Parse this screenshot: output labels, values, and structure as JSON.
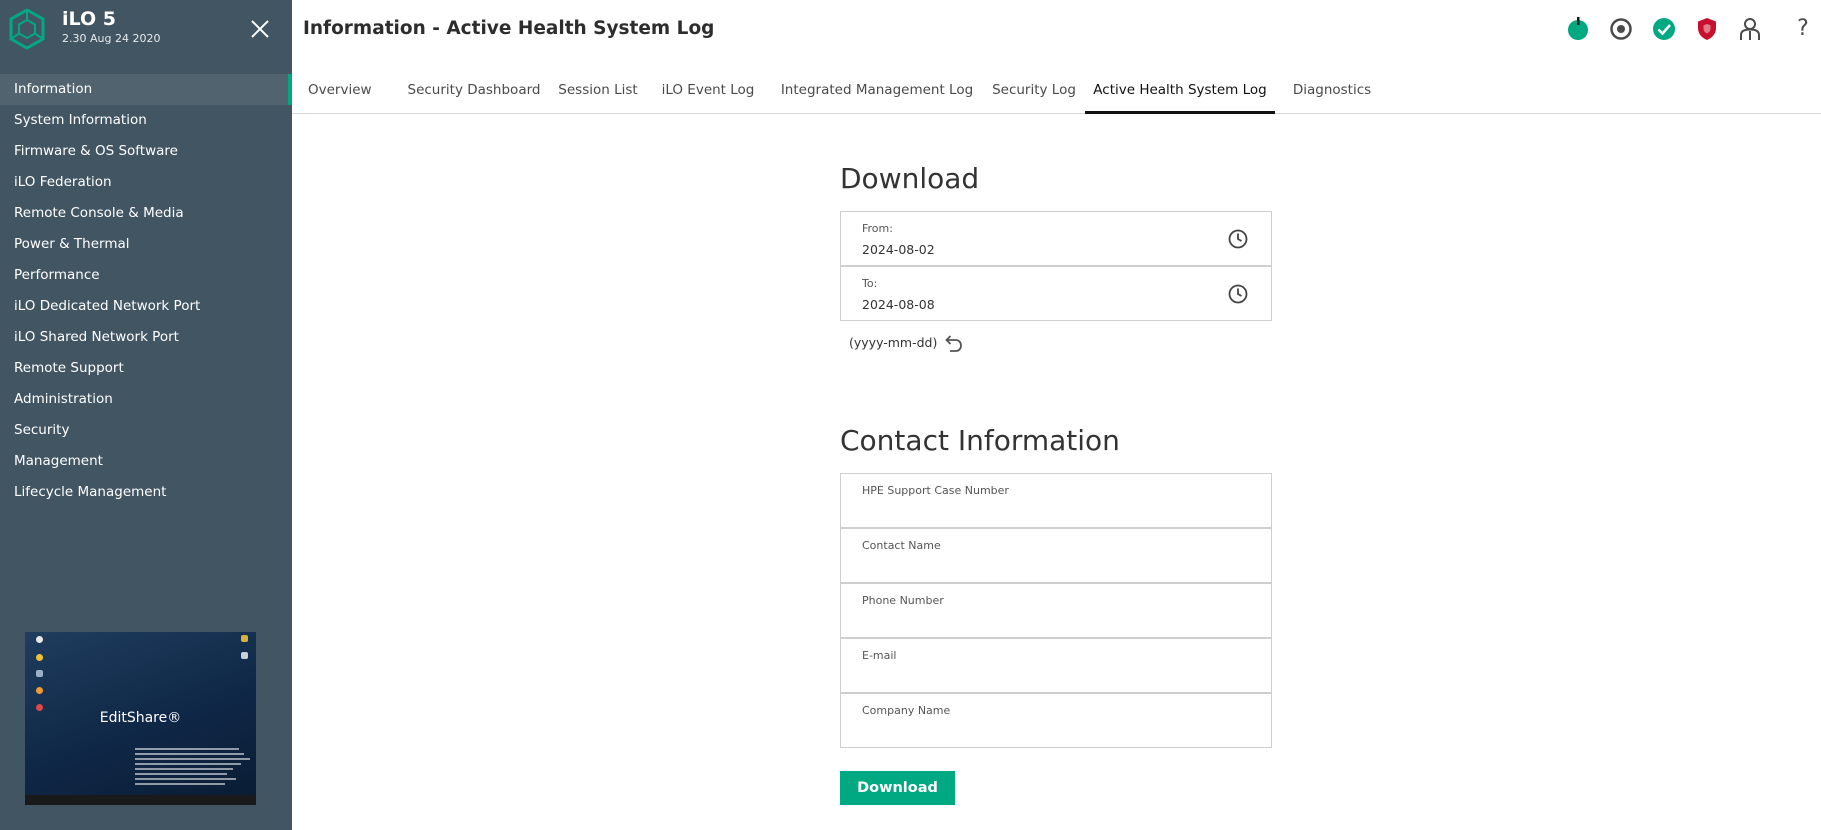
{
  "brand": {
    "name": "iLO 5",
    "version": "2.30 Aug 24 2020"
  },
  "sidebar": {
    "items": [
      {
        "label": "Information",
        "active": true
      },
      {
        "label": "System Information"
      },
      {
        "label": "Firmware & OS Software"
      },
      {
        "label": "iLO Federation"
      },
      {
        "label": "Remote Console & Media"
      },
      {
        "label": "Power & Thermal"
      },
      {
        "label": "Performance"
      },
      {
        "label": "iLO Dedicated Network Port"
      },
      {
        "label": "iLO Shared Network Port"
      },
      {
        "label": "Remote Support"
      },
      {
        "label": "Administration"
      },
      {
        "label": "Security"
      },
      {
        "label": "Management"
      },
      {
        "label": "Lifecycle Management"
      }
    ],
    "thumbnail": {
      "logo_text": "EditShare®"
    }
  },
  "header": {
    "title": "Information - Active Health System Log",
    "icons": [
      "power-status-icon",
      "uid-indicator-icon",
      "health-ok-icon",
      "security-shield-icon",
      "user-icon",
      "help-icon"
    ],
    "help_glyph": "?"
  },
  "tabs": [
    {
      "label": "Overview"
    },
    {
      "label": "Security Dashboard"
    },
    {
      "label": "Session List"
    },
    {
      "label": "iLO Event Log"
    },
    {
      "label": "Integrated Management Log"
    },
    {
      "label": "Security Log"
    },
    {
      "label": "Active Health System Log",
      "active": true
    },
    {
      "label": "Diagnostics"
    }
  ],
  "download": {
    "title": "Download",
    "from_label": "From:",
    "from_value": "2024-08-02",
    "to_label": "To:",
    "to_value": "2024-08-08",
    "format_hint": "(yyyy-mm-dd)"
  },
  "contact": {
    "title": "Contact Information",
    "case_label": "HPE Support Case Number",
    "name_label": "Contact Name",
    "phone_label": "Phone Number",
    "email_label": "E-mail",
    "company_label": "Company Name"
  },
  "actions": {
    "download_label": "Download"
  },
  "colors": {
    "sidebar_bg": "#425563",
    "accent": "#01a982",
    "security_red": "#c8102e"
  }
}
